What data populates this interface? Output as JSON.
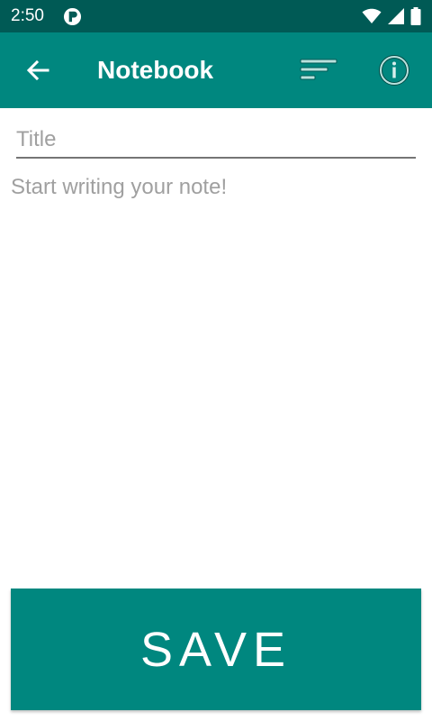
{
  "status_bar": {
    "time": "2:50",
    "background_color": "#005a55",
    "icons": [
      "app-notification-icon",
      "wifi-icon",
      "signal-icon",
      "battery-icon"
    ]
  },
  "app_bar": {
    "title": "Notebook",
    "background_color": "#00877f",
    "icons": [
      "back-arrow-icon",
      "sort-icon",
      "info-icon"
    ]
  },
  "editor": {
    "title_placeholder": "Title",
    "title_value": "",
    "body_placeholder": "Start writing your note!",
    "body_value": ""
  },
  "save_button": {
    "label": "SAVE",
    "color": "#00877f"
  }
}
